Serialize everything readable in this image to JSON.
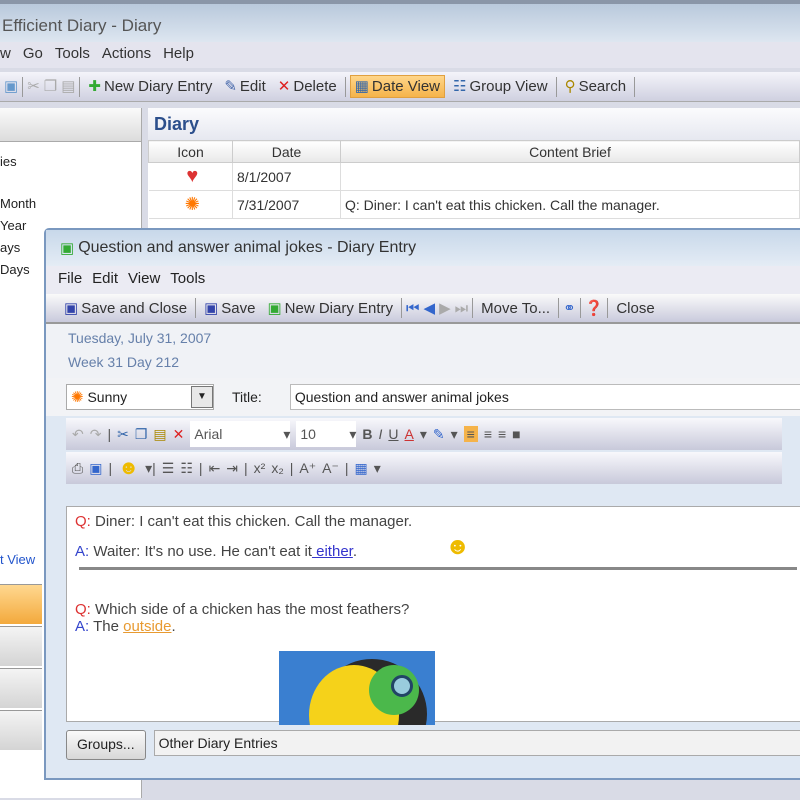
{
  "window": {
    "title": "Efficient Diary - Diary"
  },
  "menu": [
    "w",
    "Go",
    "Tools",
    "Actions",
    "Help"
  ],
  "toolbar": {
    "new": "New Diary Entry",
    "edit": "Edit",
    "delete": "Delete",
    "date_view": "Date View",
    "group_view": "Group View",
    "search": "Search"
  },
  "left": {
    "items": [
      "ies",
      "Month",
      "Year",
      "ays",
      "Days"
    ],
    "link": "t View"
  },
  "diary": {
    "title": "Diary",
    "columns": [
      "Icon",
      "Date",
      "Content Brief"
    ],
    "rows": [
      {
        "icon": "heart",
        "date": "8/1/2007",
        "brief": ""
      },
      {
        "icon": "sun",
        "date": "7/31/2007",
        "brief": "Q: Diner: I can't eat this chicken. Call the manager."
      }
    ]
  },
  "dialog": {
    "title": "Question and answer animal jokes - Diary Entry",
    "menu": [
      "File",
      "Edit",
      "View",
      "Tools"
    ],
    "toolbar": {
      "save_close": "Save and Close",
      "save": "Save",
      "new": "New Diary Entry",
      "move": "Move To...",
      "close": "Close"
    },
    "date": "Tuesday, July 31, 2007",
    "week": "Week 31 Day 212",
    "weather": "Sunny",
    "title_label": "Title:",
    "title_value": "Question and answer animal jokes",
    "font": "Arial",
    "size": "10",
    "content": {
      "q1_label": "Q:",
      "q1": " Diner: I can't eat this chicken. Call the manager.",
      "a1_label": "A:",
      "a1": " Waiter: It's no use. He can't eat it",
      "a1_link": " either",
      "q2_label": "Q:",
      "q2": " Which side of a chicken has the most feathers?",
      "a2_label": "A:",
      "a2": " The ",
      "a2_link": "outside"
    },
    "groups_button": "Groups...",
    "groups_value": "Other Diary Entries"
  }
}
